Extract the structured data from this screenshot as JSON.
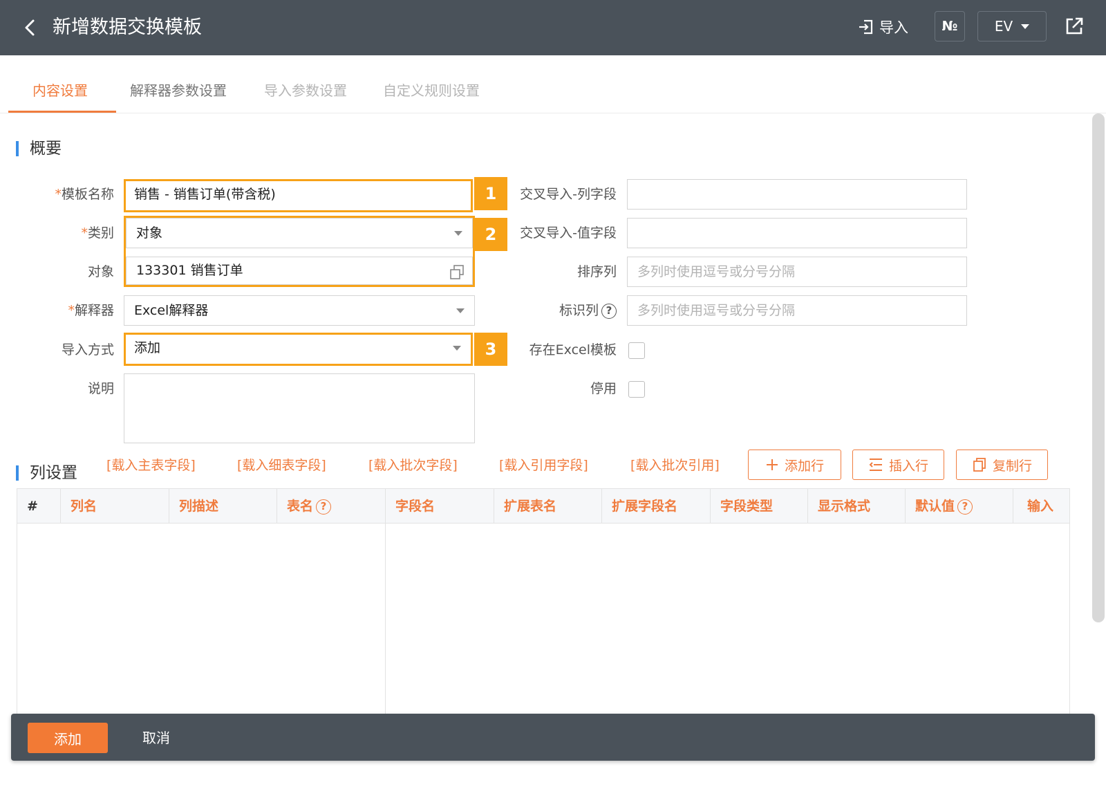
{
  "header": {
    "title": "新增数据交换模板",
    "import_label": "导入",
    "no_label": "№",
    "lang_label": "EV",
    "back_icon": "chevron-left-icon",
    "export_icon": "external-link-icon"
  },
  "tabs": [
    {
      "label": "内容设置",
      "active": true
    },
    {
      "label": "解释器参数设置",
      "active": false
    },
    {
      "label": "导入参数设置",
      "active": false
    },
    {
      "label": "自定义规则设置",
      "active": false
    }
  ],
  "overview": {
    "title": "概要",
    "template_name": {
      "label": "模板名称",
      "value": "销售 - 销售订单(带含税)"
    },
    "category": {
      "label": "类别",
      "value": "对象"
    },
    "object": {
      "label": "对象",
      "value": "133301 销售订单"
    },
    "interpreter": {
      "label": "解释器",
      "value": "Excel解释器"
    },
    "import_mode": {
      "label": "导入方式",
      "value": "添加"
    },
    "description": {
      "label": "说明",
      "value": ""
    },
    "cross_col": {
      "label": "交叉导入-列字段",
      "value": ""
    },
    "cross_val": {
      "label": "交叉导入-值字段",
      "value": ""
    },
    "sort_col": {
      "label": "排序列",
      "placeholder": "多列时使用逗号或分号分隔"
    },
    "id_col": {
      "label": "标识列",
      "placeholder": "多列时使用逗号或分号分隔"
    },
    "has_excel": {
      "label": "存在Excel模板",
      "checked": false
    },
    "disabled": {
      "label": "停用",
      "checked": false
    },
    "badges": [
      "1",
      "2",
      "3"
    ],
    "required_mark": "*",
    "help_mark": "?"
  },
  "columns": {
    "title": "列设置",
    "load_links": [
      "[载入主表字段]",
      "[载入细表字段]",
      "[载入批次字段]",
      "[载入引用字段]",
      "[载入批次引用]"
    ],
    "buttons": {
      "add_row": "添加行",
      "insert_row": "插入行",
      "copy_row": "复制行"
    },
    "table_headers": [
      "#",
      "列名",
      "列描述",
      "表名",
      "字段名",
      "扩展表名",
      "扩展字段名",
      "字段类型",
      "显示格式",
      "默认值",
      "输入"
    ]
  },
  "footer": {
    "add": "添加",
    "cancel": "取消"
  },
  "colors": {
    "accent": "#f07c3e",
    "header_bg": "#4a525a",
    "highlight": "#f7a218",
    "section_bar": "#3a8ee6"
  }
}
